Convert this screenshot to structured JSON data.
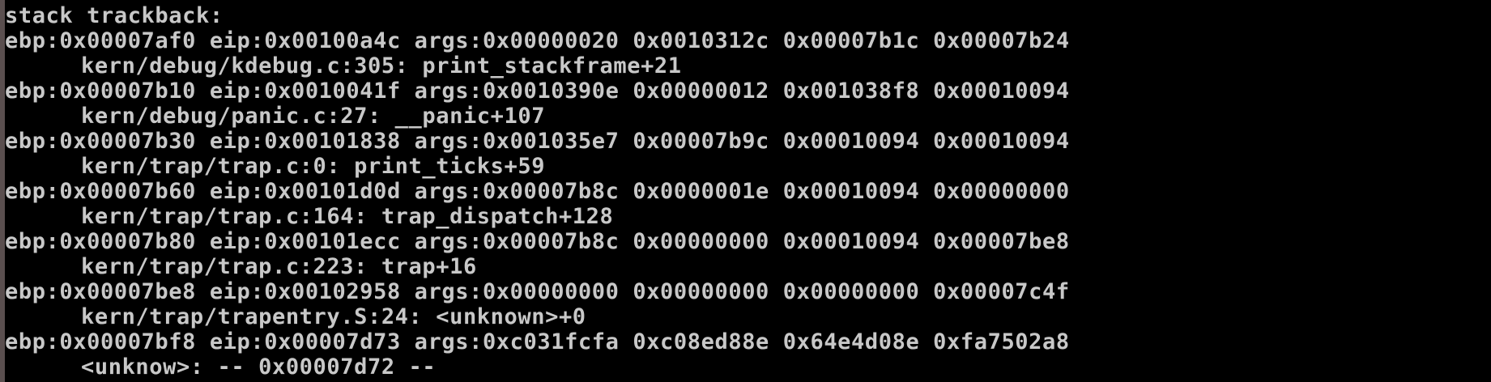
{
  "terminal": {
    "text_color": "#c8c8c8",
    "background_color": "#000000",
    "lines": [
      {
        "text": "stack trackback:",
        "indent": false
      },
      {
        "text": "ebp:0x00007af0 eip:0x00100a4c args:0x00000020 0x0010312c 0x00007b1c 0x00007b24",
        "indent": false
      },
      {
        "text": "kern/debug/kdebug.c:305: print_stackframe+21",
        "indent": true
      },
      {
        "text": "ebp:0x00007b10 eip:0x0010041f args:0x0010390e 0x00000012 0x001038f8 0x00010094",
        "indent": false
      },
      {
        "text": "kern/debug/panic.c:27: __panic+107",
        "indent": true
      },
      {
        "text": "ebp:0x00007b30 eip:0x00101838 args:0x001035e7 0x00007b9c 0x00010094 0x00010094",
        "indent": false
      },
      {
        "text": "kern/trap/trap.c:0: print_ticks+59",
        "indent": true
      },
      {
        "text": "ebp:0x00007b60 eip:0x00101d0d args:0x00007b8c 0x0000001e 0x00010094 0x00000000",
        "indent": false
      },
      {
        "text": "kern/trap/trap.c:164: trap_dispatch+128",
        "indent": true
      },
      {
        "text": "ebp:0x00007b80 eip:0x00101ecc args:0x00007b8c 0x00000000 0x00010094 0x00007be8",
        "indent": false
      },
      {
        "text": "kern/trap/trap.c:223: trap+16",
        "indent": true
      },
      {
        "text": "ebp:0x00007be8 eip:0x00102958 args:0x00000000 0x00000000 0x00000000 0x00007c4f",
        "indent": false
      },
      {
        "text": "kern/trap/trapentry.S:24: <unknown>+0",
        "indent": true
      },
      {
        "text": "ebp:0x00007bf8 eip:0x00007d73 args:0xc031fcfa 0xc08ed88e 0x64e4d08e 0xfa7502a8",
        "indent": false
      },
      {
        "text": "<unknow>: -- 0x00007d72 --",
        "indent": true
      }
    ]
  }
}
